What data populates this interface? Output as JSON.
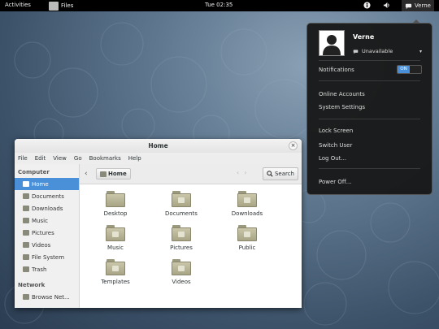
{
  "topbar": {
    "activities": "Activities",
    "app_label": "Files",
    "clock": "Tue 02:35",
    "user": "Verne",
    "status_icons": [
      "accessibility-icon",
      "volume-icon",
      "network-icon",
      "chat-icon"
    ]
  },
  "window": {
    "title": "Home",
    "close": "×",
    "menu": [
      "File",
      "Edit",
      "View",
      "Go",
      "Bookmarks",
      "Help"
    ],
    "sidebar": {
      "computer_heading": "Computer",
      "items": [
        "Home",
        "Documents",
        "Downloads",
        "Music",
        "Pictures",
        "Videos",
        "File System",
        "Trash"
      ],
      "active_index": 0,
      "network_heading": "Network",
      "network_items": [
        "Browse Net..."
      ]
    },
    "toolbar": {
      "back": "‹",
      "path": "Home",
      "search": "Search"
    },
    "files": [
      "Desktop",
      "Documents",
      "Downloads",
      "Music",
      "Pictures",
      "Public",
      "Templates",
      "Videos"
    ]
  },
  "user_menu": {
    "name": "Verne",
    "status": "Unavailable",
    "notifications_label": "Notifications",
    "toggle_state": "ON",
    "items_group1": [
      "Online Accounts",
      "System Settings"
    ],
    "items_group2": [
      "Lock Screen",
      "Switch User",
      "Log Out..."
    ],
    "items_group3": [
      "Power Off..."
    ]
  }
}
